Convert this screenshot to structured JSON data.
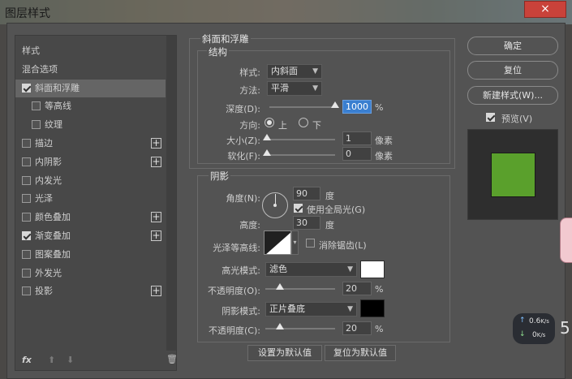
{
  "window": {
    "title": "图层样式",
    "close": "×"
  },
  "left": {
    "items": [
      {
        "label": "样式",
        "check": false,
        "checked": false,
        "plus": false,
        "indent": 0,
        "selected": false
      },
      {
        "label": "混合选项",
        "check": false,
        "checked": false,
        "plus": false,
        "indent": 0,
        "selected": false
      },
      {
        "label": "斜面和浮雕",
        "check": true,
        "checked": true,
        "plus": false,
        "indent": 0,
        "selected": true
      },
      {
        "label": "等高线",
        "check": true,
        "checked": false,
        "plus": false,
        "indent": 1,
        "selected": false
      },
      {
        "label": "纹理",
        "check": true,
        "checked": false,
        "plus": false,
        "indent": 1,
        "selected": false
      },
      {
        "label": "描边",
        "check": true,
        "checked": false,
        "plus": true,
        "indent": 0,
        "selected": false
      },
      {
        "label": "内阴影",
        "check": true,
        "checked": false,
        "plus": true,
        "indent": 0,
        "selected": false
      },
      {
        "label": "内发光",
        "check": true,
        "checked": false,
        "plus": false,
        "indent": 0,
        "selected": false
      },
      {
        "label": "光泽",
        "check": true,
        "checked": false,
        "plus": false,
        "indent": 0,
        "selected": false
      },
      {
        "label": "颜色叠加",
        "check": true,
        "checked": false,
        "plus": true,
        "indent": 0,
        "selected": false
      },
      {
        "label": "渐变叠加",
        "check": true,
        "checked": true,
        "plus": true,
        "indent": 0,
        "selected": false
      },
      {
        "label": "图案叠加",
        "check": true,
        "checked": false,
        "plus": false,
        "indent": 0,
        "selected": false
      },
      {
        "label": "外发光",
        "check": true,
        "checked": false,
        "plus": false,
        "indent": 0,
        "selected": false
      },
      {
        "label": "投影",
        "check": true,
        "checked": false,
        "plus": true,
        "indent": 0,
        "selected": false
      }
    ],
    "fx": "fx"
  },
  "bevel": {
    "group_title": "斜面和浮雕",
    "struct_title": "结构",
    "style_label": "样式:",
    "style_value": "内斜面",
    "method_label": "方法:",
    "method_value": "平滑",
    "depth_label": "深度(D):",
    "depth_value": "1000",
    "depth_unit": "%",
    "direction_label": "方向:",
    "dir_up": "上",
    "dir_down": "下",
    "size_label": "大小(Z):",
    "size_value": "1",
    "size_unit": "像素",
    "soften_label": "软化(F):",
    "soften_value": "0",
    "soften_unit": "像素"
  },
  "shading": {
    "title": "阴影",
    "angle_label": "角度(N):",
    "angle_value": "90",
    "angle_unit": "度",
    "global_light": "使用全局光(G)",
    "altitude_label": "高度:",
    "altitude_value": "30",
    "altitude_unit": "度",
    "gloss_label": "光泽等高线:",
    "antialias": "消除锯齿(L)",
    "highlight_label": "高光模式:",
    "highlight_value": "滤色",
    "highlight_color": "#ffffff",
    "hl_opacity_label": "不透明度(O):",
    "hl_opacity_value": "20",
    "hl_opacity_unit": "%",
    "shadow_label": "阴影模式:",
    "shadow_value": "正片叠底",
    "shadow_color": "#000000",
    "sh_opacity_label": "不透明度(C):",
    "sh_opacity_value": "20",
    "sh_opacity_unit": "%"
  },
  "buttons": {
    "make_default": "设置为默认值",
    "reset_default": "复位为默认值",
    "ok": "确定",
    "reset": "复位",
    "new_style": "新建样式(W)...",
    "preview": "预览(V)"
  },
  "preview_color": "#5aa02c",
  "network": {
    "up": "0.6",
    "down": "0",
    "unit": "K/s",
    "badge": "5"
  }
}
